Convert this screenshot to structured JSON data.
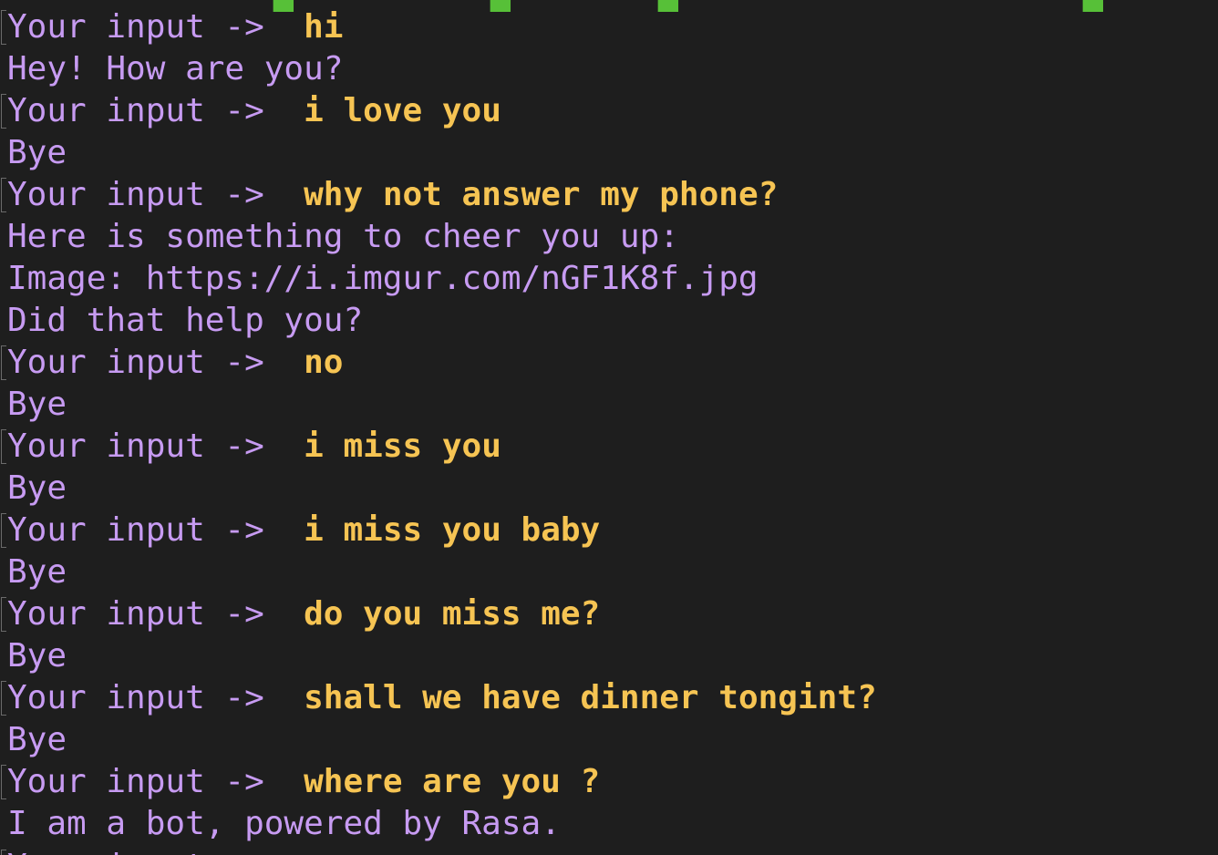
{
  "terminal": {
    "colors": {
      "background": "#1e1e1e",
      "prompt": "#c79bf2",
      "user_input": "#f6c453",
      "bot_reply": "#c79bf2",
      "cut_off_top_line": "#57c038"
    },
    "prompt_label": "Your input ->",
    "transcript": [
      {
        "kind": "input",
        "prompt": "Your input ->",
        "text": "hi"
      },
      {
        "kind": "output",
        "text": "Hey! How are you?"
      },
      {
        "kind": "input",
        "prompt": "Your input ->",
        "text": "i love you"
      },
      {
        "kind": "output",
        "text": "Bye"
      },
      {
        "kind": "input",
        "prompt": "Your input ->",
        "text": "why not answer my phone?"
      },
      {
        "kind": "output",
        "text": "Here is something to cheer you up:"
      },
      {
        "kind": "output",
        "text": "Image: https://i.imgur.com/nGF1K8f.jpg"
      },
      {
        "kind": "output",
        "text": "Did that help you?"
      },
      {
        "kind": "input",
        "prompt": "Your input ->",
        "text": "no"
      },
      {
        "kind": "output",
        "text": "Bye"
      },
      {
        "kind": "input",
        "prompt": "Your input ->",
        "text": "i miss you"
      },
      {
        "kind": "output",
        "text": "Bye"
      },
      {
        "kind": "input",
        "prompt": "Your input ->",
        "text": "i miss you baby"
      },
      {
        "kind": "output",
        "text": "Bye"
      },
      {
        "kind": "input",
        "prompt": "Your input ->",
        "text": "do you miss me?"
      },
      {
        "kind": "output",
        "text": "Bye"
      },
      {
        "kind": "input",
        "prompt": "Your input ->",
        "text": "shall we have dinner tongint?"
      },
      {
        "kind": "output",
        "text": "Bye"
      },
      {
        "kind": "input",
        "prompt": "Your input ->",
        "text": "where are you ?"
      },
      {
        "kind": "output",
        "text": "I am a bot, powered by Rasa."
      }
    ]
  }
}
